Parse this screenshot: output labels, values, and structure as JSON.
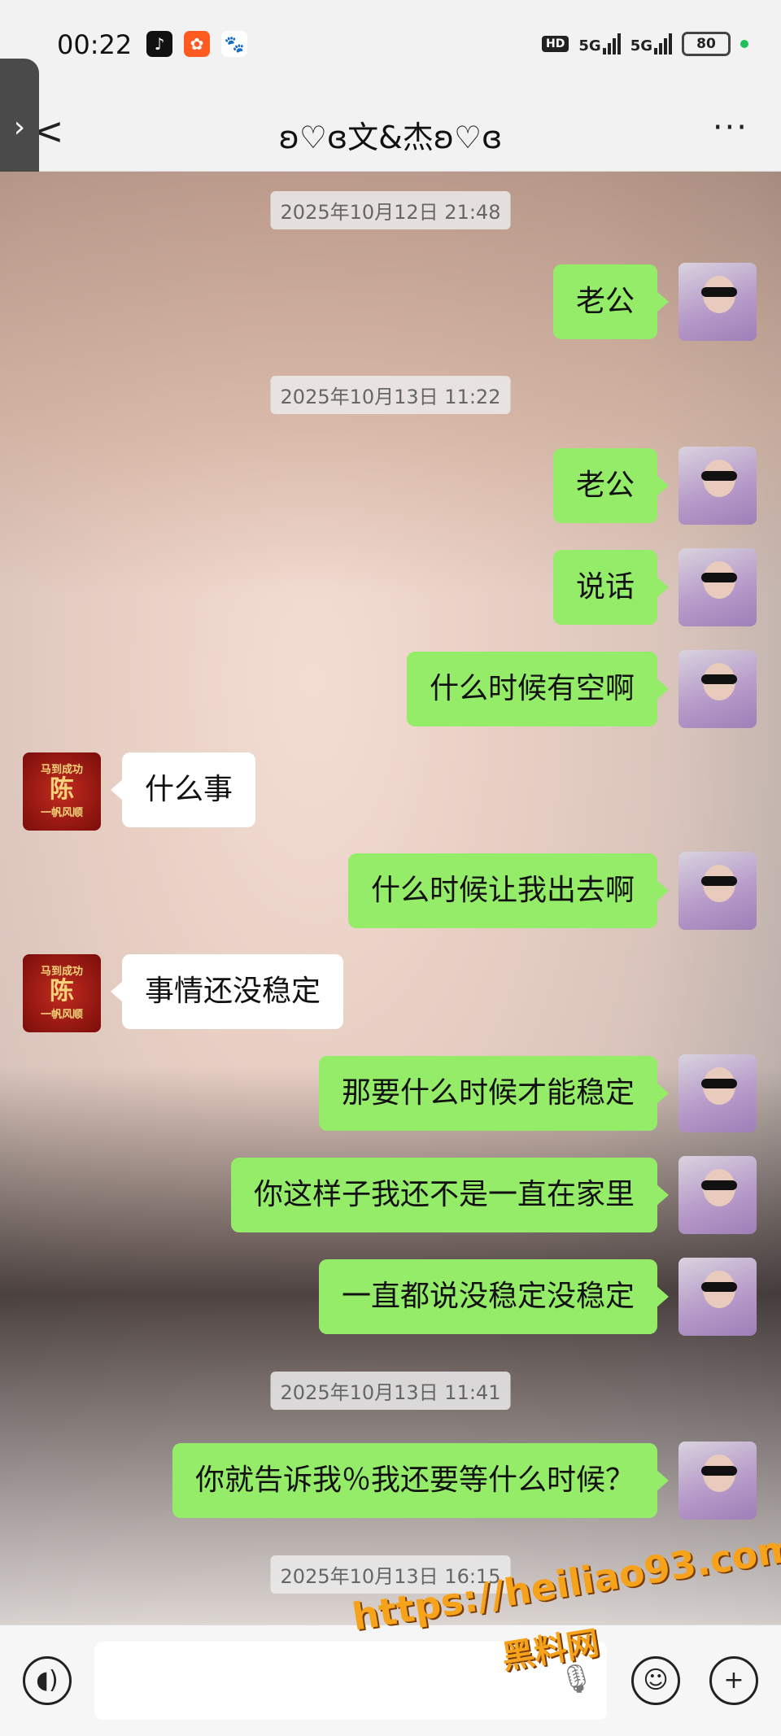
{
  "status_bar": {
    "time": "00:22",
    "hd_label": "HD",
    "signal1": "5G",
    "signal2": "5G",
    "battery": "80"
  },
  "header": {
    "title": "ʚ♡ɞ文&杰ʚ♡ɞ",
    "back_icon": "chevron-left-icon",
    "more_icon": "more-icon"
  },
  "messages": [
    {
      "type": "time",
      "text": "2025年10月12日 21:48"
    },
    {
      "type": "me",
      "text": "老公"
    },
    {
      "type": "time",
      "text": "2025年10月13日 11:22"
    },
    {
      "type": "me",
      "text": "老公"
    },
    {
      "type": "me",
      "text": "说话"
    },
    {
      "type": "me",
      "text": "什么时候有空啊"
    },
    {
      "type": "them",
      "text": "什么事"
    },
    {
      "type": "me",
      "text": "什么时候让我出去啊"
    },
    {
      "type": "them",
      "text": "事情还没稳定"
    },
    {
      "type": "me",
      "text": "那要什么时候才能稳定"
    },
    {
      "type": "me",
      "text": "你这样子我还不是一直在家里"
    },
    {
      "type": "me",
      "text": "一直都说没稳定没稳定"
    },
    {
      "type": "time",
      "text": "2025年10月13日 11:41"
    },
    {
      "type": "me",
      "text": "你就告诉我％我还要等什么时候？"
    },
    {
      "type": "time",
      "text": "2025年10月13日 16:15"
    }
  ],
  "contact_avatar": {
    "line1": "马到成功",
    "line2": "陈",
    "line3": "一帆风顺"
  },
  "watermark": {
    "url": "https://heiliao93.com",
    "name": "黑料网"
  },
  "input_bar": {
    "voice_icon": "voice-icon",
    "mic_icon": "microphone-icon",
    "emoji_icon": "emoji-icon",
    "plus_icon": "plus-icon"
  }
}
